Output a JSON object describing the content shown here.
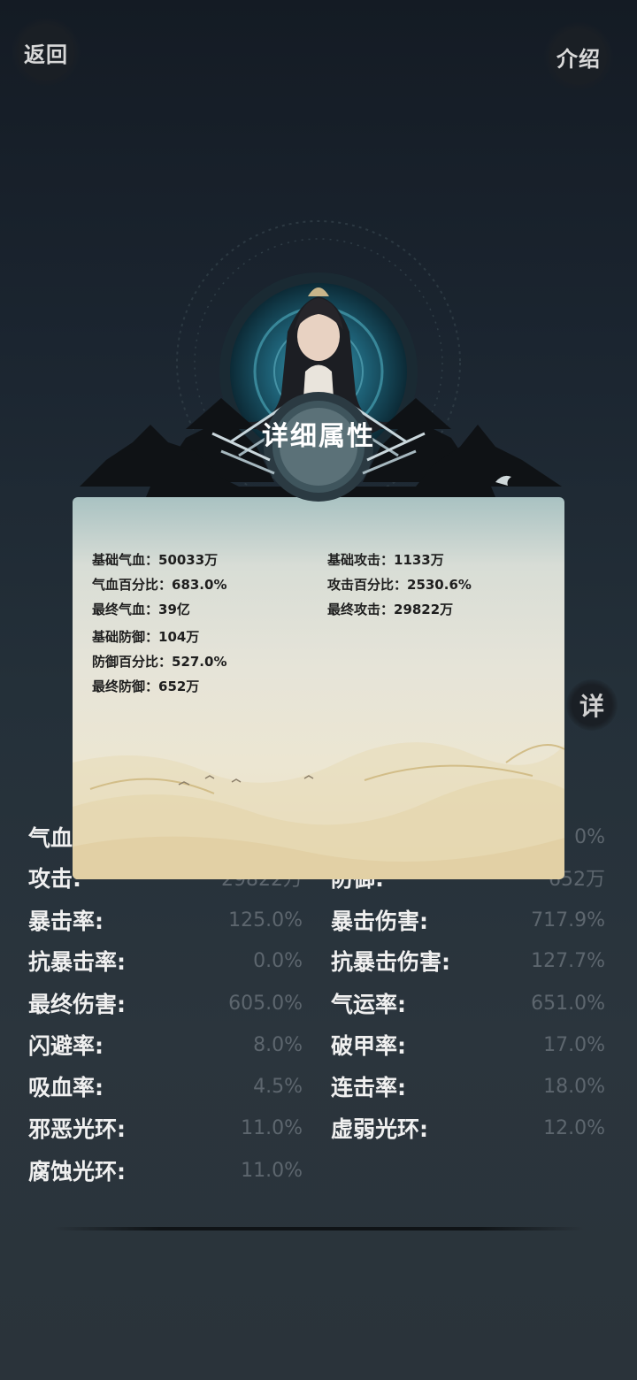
{
  "nav": {
    "back_label": "返回",
    "intro_label": "介绍",
    "side_tab_label": "详"
  },
  "popup": {
    "title": "详细属性",
    "left_attrs": [
      "基础气血：50033万",
      "气血百分比：683.0%",
      "最终气血：39亿",
      "基础防御：104万",
      "防御百分比：527.0%",
      "最终防御：652万"
    ],
    "right_attrs": [
      "基础攻击：1133万",
      "攻击百分比：2530.6%",
      "最终攻击：29822万"
    ]
  },
  "stats": {
    "left": [
      {
        "label": "气血:",
        "value": ""
      },
      {
        "label": "攻击:",
        "value": "29822万"
      },
      {
        "label": "暴击率:",
        "value": "125.0%"
      },
      {
        "label": "抗暴击率:",
        "value": "0.0%"
      },
      {
        "label": "最终伤害:",
        "value": "605.0%"
      },
      {
        "label": "闪避率:",
        "value": "8.0%"
      },
      {
        "label": "吸血率:",
        "value": "4.5%"
      },
      {
        "label": "邪恶光环:",
        "value": "11.0%"
      },
      {
        "label": "腐蚀光环:",
        "value": "11.0%"
      }
    ],
    "right": [
      {
        "label": "",
        "value": "0%"
      },
      {
        "label": "防御:",
        "value": "652万"
      },
      {
        "label": "暴击伤害:",
        "value": "717.9%"
      },
      {
        "label": "抗暴击伤害:",
        "value": "127.7%"
      },
      {
        "label": "气运率:",
        "value": "651.0%"
      },
      {
        "label": "破甲率:",
        "value": "17.0%"
      },
      {
        "label": "连击率:",
        "value": "18.0%"
      },
      {
        "label": "虚弱光环:",
        "value": "12.0%"
      }
    ]
  }
}
